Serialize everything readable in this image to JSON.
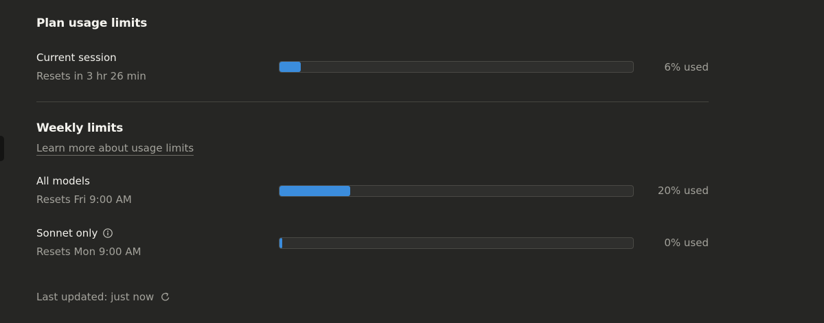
{
  "plan": {
    "title": "Plan usage limits",
    "rows": [
      {
        "label": "Current session",
        "reset": "Resets in 3 hr 26 min",
        "pct_text": "6% used",
        "fraction": 0.06
      }
    ]
  },
  "weekly": {
    "title": "Weekly limits",
    "learn_more": "Learn more about usage limits",
    "rows": [
      {
        "label": "All models",
        "reset": "Resets Fri 9:00 AM",
        "pct_text": "20% used",
        "fraction": 0.2
      },
      {
        "label": "Sonnet only",
        "reset": "Resets Mon 9:00 AM",
        "pct_text": "0% used",
        "fraction": 0.0,
        "info_icon": "info-icon"
      }
    ]
  },
  "footer": {
    "last_updated": "Last updated: just now",
    "refresh_icon": "refresh-icon"
  },
  "colors": {
    "background": "#262624",
    "bar_fill": "#3b8ddd",
    "bar_track": "#2f2f2d"
  }
}
